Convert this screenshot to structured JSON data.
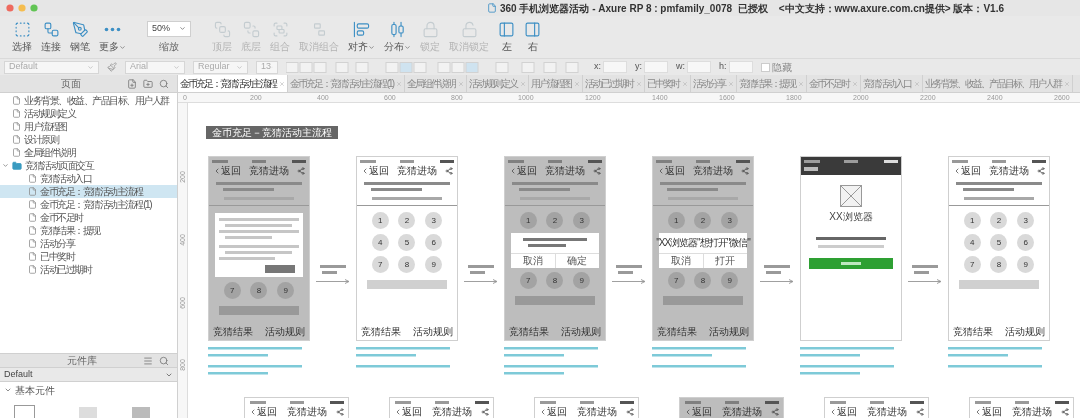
{
  "window": {
    "title": "360 手机浏览器活动 - Axure RP 8 : pmfamily_0078  已授权    <中文支持：www.axure.com.cn提供> 版本：V1.6"
  },
  "toolbar": {
    "tools": [
      {
        "kind": "tool",
        "label": "选择",
        "disabled": false,
        "menu": false
      },
      {
        "kind": "tool",
        "label": "连接",
        "disabled": false,
        "menu": false
      },
      {
        "kind": "tool",
        "label": "钢笔",
        "disabled": false,
        "menu": false
      },
      {
        "kind": "tool",
        "label": "更多",
        "disabled": false,
        "menu": true
      },
      {
        "kind": "zoom",
        "value": "50%",
        "label": "缩放"
      },
      {
        "kind": "tool",
        "label": "顶层",
        "disabled": true,
        "menu": false
      },
      {
        "kind": "tool",
        "label": "底层",
        "disabled": true,
        "menu": false
      },
      {
        "kind": "tool",
        "label": "组合",
        "disabled": true,
        "menu": false
      },
      {
        "kind": "tool",
        "label": "取消组合",
        "disabled": true,
        "menu": false
      },
      {
        "kind": "tool",
        "label": "对齐",
        "disabled": false,
        "menu": true
      },
      {
        "kind": "tool",
        "label": "分布",
        "disabled": false,
        "menu": true
      },
      {
        "kind": "tool",
        "label": "锁定",
        "disabled": true,
        "menu": false
      },
      {
        "kind": "tool",
        "label": "取消锁定",
        "disabled": true,
        "menu": false
      },
      {
        "kind": "tool",
        "label": "左",
        "disabled": false,
        "menu": false
      },
      {
        "kind": "tool",
        "label": "右",
        "disabled": false,
        "menu": false
      }
    ]
  },
  "style_bar": {
    "style": "Default",
    "font": "Arial",
    "weight": "Regular",
    "size": "13",
    "position_labels": [
      "x:",
      "y:",
      "w:",
      "h:"
    ],
    "hidden": {
      "label": "隐藏",
      "checked": false
    }
  },
  "pages_panel": {
    "title": "页面",
    "pages": [
      {
        "kind": "page",
        "label": "业务背景、收益、产品目标、用户人群",
        "selected": false
      },
      {
        "kind": "page",
        "label": "活动规则定义",
        "selected": false
      },
      {
        "kind": "page",
        "label": "用户流程图",
        "selected": false
      },
      {
        "kind": "page",
        "label": "设计原则",
        "selected": false
      },
      {
        "kind": "page",
        "label": "全局组件说明",
        "selected": false
      },
      {
        "kind": "folder",
        "label": "竞猜活动页面交互",
        "selected": false,
        "expanded": true,
        "children": [
          {
            "kind": "page",
            "label": "竞猜活动入口",
            "selected": false
          },
          {
            "kind": "page",
            "label": "金币充足：竞猜活动主流程",
            "selected": true
          },
          {
            "kind": "page",
            "label": "金币充足：竞猜活动主流程 (1)",
            "selected": false
          },
          {
            "kind": "page",
            "label": "金币不足时",
            "selected": false
          },
          {
            "kind": "page",
            "label": "竞猜结果：提现",
            "selected": false
          },
          {
            "kind": "page",
            "label": "活动分享",
            "selected": false
          },
          {
            "kind": "page",
            "label": "已中奖时",
            "selected": false
          },
          {
            "kind": "page",
            "label": "活动已过期时",
            "selected": false
          }
        ]
      }
    ]
  },
  "library_panel": {
    "title": "元件库",
    "library": "Default",
    "group": {
      "label": "基本元件",
      "expanded": true
    }
  },
  "tabs": [
    {
      "label": "金币充足：竞猜活动主流程",
      "selected": true
    },
    {
      "label": "金币充足：竞猜活动主流程 (1)",
      "selected": false
    },
    {
      "label": "全局组件说明",
      "selected": false
    },
    {
      "label": "活动规则定义",
      "selected": false
    },
    {
      "label": "用户流程图",
      "selected": false
    },
    {
      "label": "活动已过期时",
      "selected": false
    },
    {
      "label": "已中奖时",
      "selected": false
    },
    {
      "label": "活动分享",
      "selected": false
    },
    {
      "label": "竞猜结果：提现",
      "selected": false
    },
    {
      "label": "金币不足时",
      "selected": false
    },
    {
      "label": "竞猜活动入口",
      "selected": false
    },
    {
      "label": "业务背景、收益、产品目标、用户人群",
      "selected": false
    }
  ],
  "ruler": {
    "ticks": [
      "0",
      "200",
      "400",
      "600",
      "800",
      "1000",
      "1200",
      "1400",
      "1600",
      "1800",
      "2000",
      "2200",
      "2400",
      "2600"
    ],
    "vertical_ticks": [
      "200",
      "400",
      "600",
      "800"
    ]
  },
  "canvas": {
    "group_label": "金币充足－竞猜活动主流程",
    "phones": [
      {
        "kind": "keypad",
        "dimmed": true,
        "back": "返回",
        "title": "竞猜进场",
        "dialog": {
          "kind": "notice"
        },
        "keys_below": [
          "7",
          "8",
          "9"
        ],
        "footer": [
          "竞猜结果",
          "活动规则"
        ]
      },
      {
        "kind": "keypad",
        "dimmed": false,
        "back": "返回",
        "title": "竞猜进场",
        "keys_above": [
          "1",
          "2",
          "3",
          "4",
          "5",
          "6",
          "7",
          "8",
          "9"
        ],
        "footer": [
          "竞猜结果",
          "活动规则"
        ]
      },
      {
        "kind": "keypad",
        "dimmed": true,
        "back": "返回",
        "title": "竞猜进场",
        "keys_above": [
          "1",
          "2",
          "3"
        ],
        "dialog": {
          "kind": "confirm",
          "buttons": [
            "取消",
            "确定"
          ]
        },
        "keys_below": [
          "7",
          "8",
          "9"
        ],
        "footer": [
          "竞猜结果",
          "活动规则"
        ]
      },
      {
        "kind": "keypad",
        "dimmed": true,
        "back": "返回",
        "title": "竞猜进场",
        "keys_above": [
          "1",
          "2",
          "3"
        ],
        "dialog": {
          "kind": "confirm",
          "message": "\"XX浏览器\"想打开\"微信\"",
          "buttons": [
            "取消",
            "打开"
          ]
        },
        "keys_below": [
          "7",
          "8",
          "9"
        ],
        "footer": [
          "竞猜结果",
          "活动规则"
        ]
      },
      {
        "kind": "wechat",
        "app_name": "XX浏览器"
      },
      {
        "kind": "keypad",
        "dimmed": false,
        "back": "返回",
        "title": "竞猜进场",
        "keys_above": [
          "1",
          "2",
          "3",
          "4",
          "5",
          "6",
          "7",
          "8",
          "9"
        ],
        "footer": [
          "竞猜结果",
          "活动规则"
        ]
      }
    ],
    "bottom_phones": [
      {
        "dimmed": false,
        "back": "返回",
        "title": "竞猜进场"
      },
      {
        "dimmed": false,
        "back": "返回",
        "title": "竞猜进场"
      },
      {
        "dimmed": false,
        "back": "返回",
        "title": "竞猜进场"
      },
      {
        "dimmed": true,
        "back": "返回",
        "title": "竞猜进场"
      },
      {
        "dimmed": false,
        "back": "返回",
        "title": "竞猜进场"
      },
      {
        "dimmed": false,
        "back": "返回",
        "title": "竞猜进场"
      }
    ]
  }
}
